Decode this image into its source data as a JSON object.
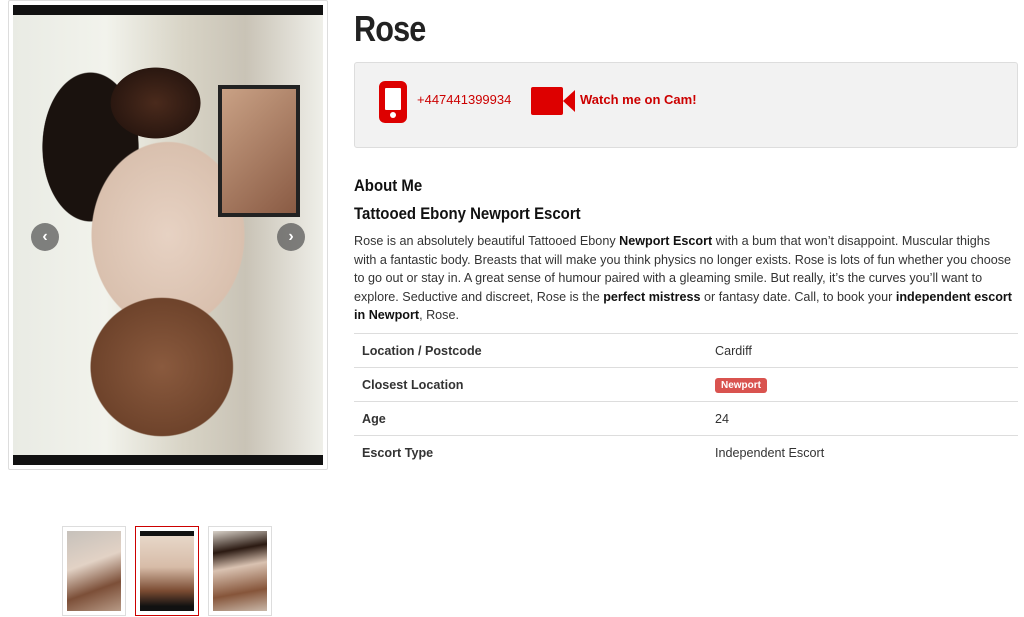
{
  "profile": {
    "name": "Rose",
    "phone": "+447441399934",
    "cam_label": "Watch me on Cam!"
  },
  "about": {
    "heading": "About Me",
    "subheading": "Tattooed Ebony Newport Escort",
    "bio": {
      "p1": "Rose is an absolutely beautiful Tattooed Ebony ",
      "b1": "Newport Escort",
      "p2": " with a bum that won’t disappoint. Muscular thighs with a fantastic body. Breasts that will make you think physics no longer exists. Rose is lots of fun whether you choose to go out or stay in. A great sense of humour paired with a gleaming smile. But really, it’s the curves you’ll want to explore. Seductive and discreet, Rose is the ",
      "b2": "perfect mistress",
      "p3": " or fantasy date. Call, to book your ",
      "b3": "independent escort in Newport",
      "p4": ", Rose."
    }
  },
  "details": [
    {
      "label": "Location / Postcode",
      "value": "Cardiff"
    },
    {
      "label": "Closest Location",
      "value": "Newport"
    },
    {
      "label": "Age",
      "value": "24"
    },
    {
      "label": "Escort Type",
      "value": "Independent Escort"
    }
  ],
  "gallery": {
    "prev_glyph": "‹",
    "next_glyph": "›",
    "thumb_count": 3,
    "active_thumb": 2
  },
  "colors": {
    "accent": "#cc0000",
    "badge": "#d9534f"
  },
  "icons": [
    "phone-icon",
    "video-camera-icon",
    "chevron-left-icon",
    "chevron-right-icon"
  ]
}
